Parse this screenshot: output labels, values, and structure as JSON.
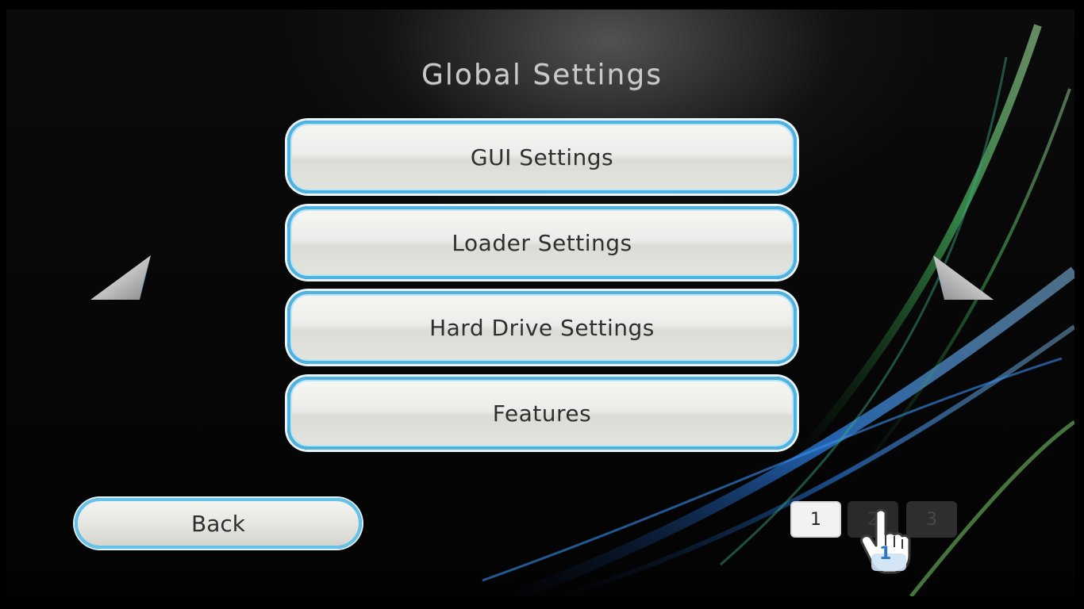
{
  "screen": {
    "title": "Global Settings"
  },
  "menu": {
    "items": [
      {
        "label": "GUI Settings"
      },
      {
        "label": "Loader Settings"
      },
      {
        "label": "Hard Drive Settings"
      },
      {
        "label": "Features"
      }
    ]
  },
  "footer": {
    "back_label": "Back"
  },
  "pager": {
    "pages": [
      "1",
      "2",
      "3"
    ],
    "current": "1"
  },
  "cursor": {
    "player_number": "1",
    "icon": "pointing-hand-cursor-icon"
  },
  "icons": {
    "prev": "prev-page-arrow-icon",
    "next": "next-page-arrow-icon"
  },
  "colors": {
    "button_border": "#4fb3e2",
    "button_face": "#ececea",
    "title_text": "#c9c9c9",
    "background": "#000000"
  }
}
